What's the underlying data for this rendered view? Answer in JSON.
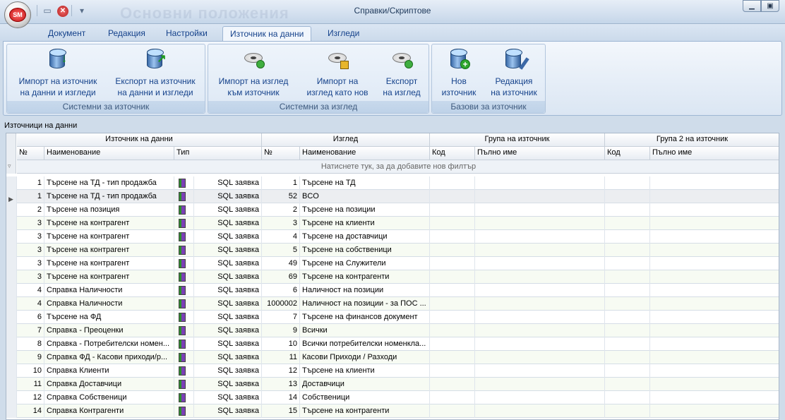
{
  "window": {
    "title": "Справки/Скриптове",
    "watermark": "Основни положения",
    "orb_label": "SM",
    "qat_menu": "▾"
  },
  "tabs": [
    {
      "label": "Документ"
    },
    {
      "label": "Редакция"
    },
    {
      "label": "Настройки"
    },
    {
      "label": "Източник на данни",
      "active": true
    },
    {
      "label": "Изгледи"
    }
  ],
  "ribbon": {
    "groups": [
      {
        "label": "Системни за източник",
        "buttons": [
          {
            "label1": "Импорт на източник",
            "label2": "на данни и изгледи",
            "icon": "database-import-icon"
          },
          {
            "label1": "Експорт на източник",
            "label2": "на данни и изгледи",
            "icon": "database-export-icon"
          }
        ]
      },
      {
        "label": "Системни за изглед",
        "buttons": [
          {
            "label1": "Импорт на изглед",
            "label2": "към източник",
            "icon": "view-import-icon"
          },
          {
            "label1": "Импорт на",
            "label2": "изглед като нов",
            "icon": "view-import-new-icon"
          },
          {
            "label1": "Експорт",
            "label2": "на изглед",
            "icon": "view-export-icon"
          }
        ]
      },
      {
        "label": "Базови за източник",
        "buttons": [
          {
            "label1": "Нов",
            "label2": "източник",
            "icon": "database-add-icon"
          },
          {
            "label1": "Редакция",
            "label2": "на източник",
            "icon": "database-edit-icon"
          }
        ]
      }
    ]
  },
  "grid": {
    "caption": "Източници на данни",
    "bands": [
      "Източник на данни",
      "Изглед",
      "Група на източник",
      "Група 2 на източник"
    ],
    "columns": [
      "№",
      "Наименование",
      "Тип",
      "№",
      "Наименование",
      "Код",
      "Пълно име",
      "Код",
      "Пълно име"
    ],
    "filter_hint": "Натиснете тук, за да добавите нов филтър",
    "rows": [
      {
        "n": "1",
        "name": "Търсене на ТД - тип продажба",
        "type": "SQL заявка",
        "vn": "1",
        "vname": "Търсене на ТД"
      },
      {
        "n": "1",
        "name": "Търсене на ТД - тип продажба",
        "type": "SQL заявка",
        "vn": "52",
        "vname": "BCO",
        "selected": true
      },
      {
        "n": "2",
        "name": "Търсене на позиция",
        "type": "SQL заявка",
        "vn": "2",
        "vname": "Търсене на позиции"
      },
      {
        "n": "3",
        "name": "Търсене на контрагент",
        "type": "SQL заявка",
        "vn": "3",
        "vname": "Търсене на клиенти"
      },
      {
        "n": "3",
        "name": "Търсене на контрагент",
        "type": "SQL заявка",
        "vn": "4",
        "vname": "Търсене на доставчици"
      },
      {
        "n": "3",
        "name": "Търсене на контрагент",
        "type": "SQL заявка",
        "vn": "5",
        "vname": "Търсене на собственици"
      },
      {
        "n": "3",
        "name": "Търсене на контрагент",
        "type": "SQL заявка",
        "vn": "49",
        "vname": "Търсене на Служители"
      },
      {
        "n": "3",
        "name": "Търсене на контрагент",
        "type": "SQL заявка",
        "vn": "69",
        "vname": "Търсене на контрагенти"
      },
      {
        "n": "4",
        "name": "Справка Наличности",
        "type": "SQL заявка",
        "vn": "6",
        "vname": "Наличност на позиции"
      },
      {
        "n": "4",
        "name": "Справка Наличности",
        "type": "SQL заявка",
        "vn": "1000002",
        "vname": "Наличност на позиции - за ПОС ..."
      },
      {
        "n": "6",
        "name": "Търсене на ФД",
        "type": "SQL заявка",
        "vn": "7",
        "vname": "Търсене на финансов документ"
      },
      {
        "n": "7",
        "name": "Справка - Преоценки",
        "type": "SQL заявка",
        "vn": "9",
        "vname": "Всички"
      },
      {
        "n": "8",
        "name": "Справка - Потребителски номен...",
        "type": "SQL заявка",
        "vn": "10",
        "vname": "Всички потребителски номенкла..."
      },
      {
        "n": "9",
        "name": "Справка ФД - Касови приходи/р...",
        "type": "SQL заявка",
        "vn": "11",
        "vname": "Касови Приходи / Разходи"
      },
      {
        "n": "10",
        "name": "Справка Клиенти",
        "type": "SQL заявка",
        "vn": "12",
        "vname": "Търсене на клиенти"
      },
      {
        "n": "11",
        "name": "Справка Доставчици",
        "type": "SQL заявка",
        "vn": "13",
        "vname": "Доставчици"
      },
      {
        "n": "12",
        "name": "Справка Собственици",
        "type": "SQL заявка",
        "vn": "14",
        "vname": "Собственици"
      },
      {
        "n": "14",
        "name": "Справка Контрагенти",
        "type": "SQL заявка",
        "vn": "15",
        "vname": "Търсене на контрагенти"
      }
    ]
  }
}
